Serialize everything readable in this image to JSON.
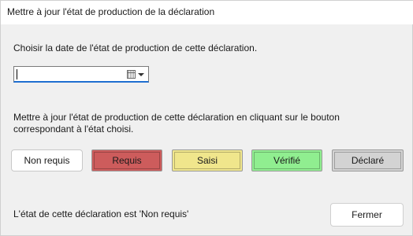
{
  "window": {
    "title": "Mettre à jour l'état de production de la déclaration"
  },
  "date_section": {
    "instruction": "Choisir la date de l'état de production de cette déclaration.",
    "date_value": "",
    "icon": "calendar-icon"
  },
  "state_section": {
    "instruction": "Mettre à jour l'état de production de cette déclaration en cliquant sur le bouton correspondant à l'état choisi.",
    "buttons": [
      {
        "label": "Non requis",
        "color": "#ffffff"
      },
      {
        "label": "Requis",
        "color": "#cd5c5c"
      },
      {
        "label": "Saisi",
        "color": "#f0e68c"
      },
      {
        "label": "Vérifié",
        "color": "#90ee90"
      },
      {
        "label": "Déclaré",
        "color": "#d3d3d3"
      }
    ]
  },
  "footer": {
    "status": "L'état de cette déclaration est 'Non requis'",
    "close_label": "Fermer"
  }
}
